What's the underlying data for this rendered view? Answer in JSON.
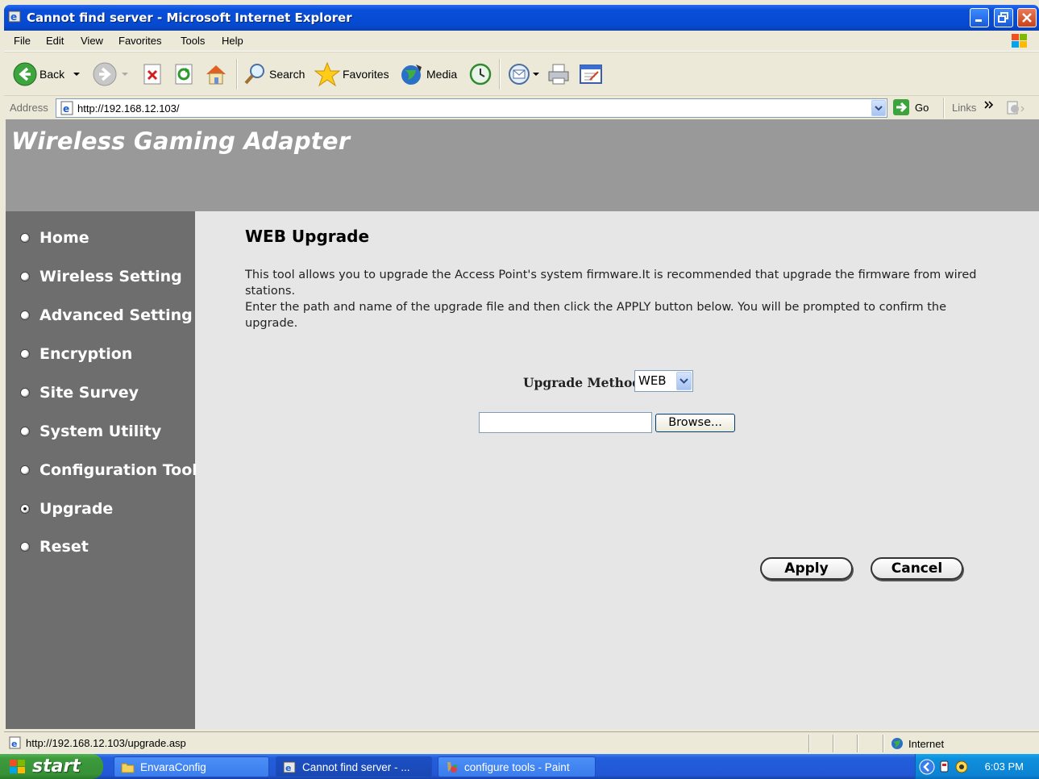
{
  "window": {
    "title": "Cannot find server - Microsoft Internet Explorer"
  },
  "menu": [
    "File",
    "Edit",
    "View",
    "Favorites",
    "Tools",
    "Help"
  ],
  "toolbar": {
    "back_label": "Back",
    "search_label": "Search",
    "favorites_label": "Favorites",
    "media_label": "Media"
  },
  "address": {
    "label": "Address",
    "url": "http://192.168.12.103/",
    "go_label": "Go",
    "links_label": "Links"
  },
  "page": {
    "brand": "Wireless Gaming Adapter",
    "nav": [
      {
        "label": "Home",
        "active": false
      },
      {
        "label": "Wireless Setting",
        "active": false
      },
      {
        "label": "Advanced Setting",
        "active": false
      },
      {
        "label": "Encryption",
        "active": false
      },
      {
        "label": "Site Survey",
        "active": false
      },
      {
        "label": "System Utility",
        "active": false
      },
      {
        "label": "Configuration Tool",
        "active": false
      },
      {
        "label": "Upgrade",
        "active": true
      },
      {
        "label": "Reset",
        "active": false
      }
    ],
    "title": "WEB Upgrade",
    "desc_line1": "This tool allows you to upgrade the Access Point's system firmware.It is recommended that upgrade the firmware from wired stations.",
    "desc_line2": "Enter the path and name of the upgrade file and then click the APPLY button below. You will be prompted to confirm the upgrade.",
    "upgrade_method_label": "Upgrade Method",
    "upgrade_method_value": "WEB",
    "file_path_value": "",
    "browse_label": "Browse...",
    "apply_label": "Apply",
    "cancel_label": "Cancel"
  },
  "status": {
    "text": "http://192.168.12.103/upgrade.asp",
    "zone": "Internet"
  },
  "taskbar": {
    "start_label": "start",
    "tasks": [
      {
        "label": "EnvaraConfig",
        "icon": "folder-icon",
        "active": false
      },
      {
        "label": "Cannot find server - ...",
        "icon": "ie-icon",
        "active": true
      },
      {
        "label": "configure tools - Paint",
        "icon": "paint-icon",
        "active": false
      }
    ],
    "clock": "6:03 PM"
  },
  "colors": {
    "header_bg": "#999999",
    "sidebar_bg": "#6e6e6e",
    "content_bg": "#e6e6e6",
    "titlebar_blue": "#0549d0"
  }
}
